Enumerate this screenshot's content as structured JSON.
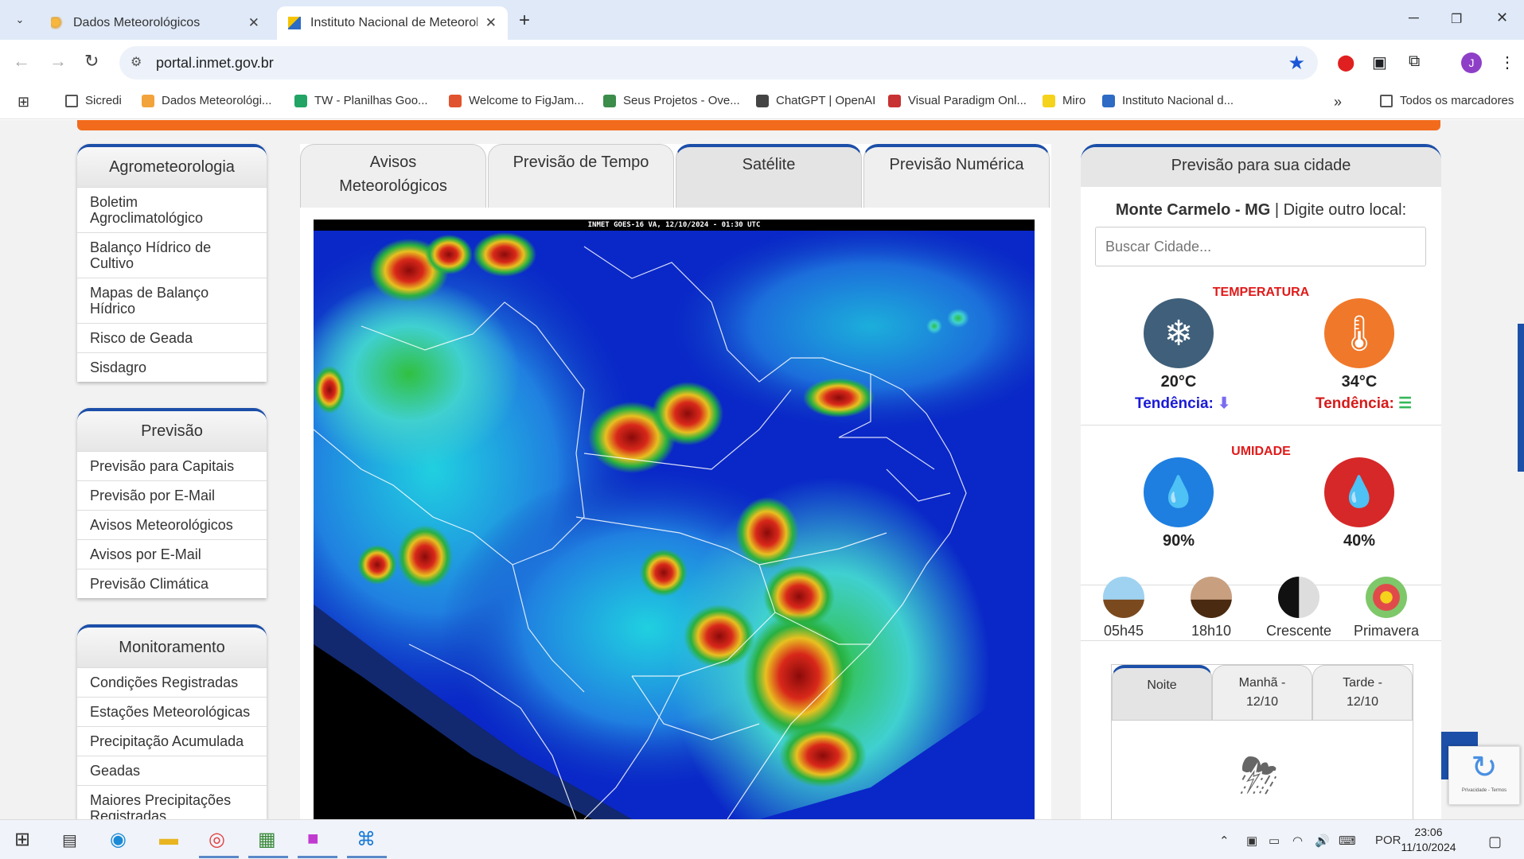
{
  "browser": {
    "tabs": [
      {
        "title": "Dados Meteorológicos"
      },
      {
        "title": "Instituto Nacional de Meteorolo"
      }
    ],
    "url": "portal.inmet.gov.br",
    "avatar_letter": "J",
    "bookmarks": [
      {
        "label": "Sicredi",
        "color": "#666"
      },
      {
        "label": "Dados Meteorológi...",
        "color": "#f2a33c"
      },
      {
        "label": "TW - Planilhas Goo...",
        "color": "#21a464"
      },
      {
        "label": "Welcome to FigJam...",
        "color": "#e0532e"
      },
      {
        "label": "Seus Projetos - Ove...",
        "color": "#3c8c4a"
      },
      {
        "label": "ChatGPT | OpenAI",
        "color": "#444"
      },
      {
        "label": "Visual Paradigm Onl...",
        "color": "#c83232"
      },
      {
        "label": "Miro",
        "color": "#f5d21b"
      },
      {
        "label": "Instituto Nacional d...",
        "color": "#2d6bc4"
      }
    ],
    "all_bookmarks": "Todos os marcadores"
  },
  "sidebar": [
    {
      "title": "Agrometeorologia",
      "items": [
        "Boletim Agroclimatológico",
        "Balanço Hídrico de Cultivo",
        "Mapas de Balanço Hídrico",
        "Risco de Geada",
        "Sisdagro"
      ]
    },
    {
      "title": "Previsão",
      "items": [
        "Previsão para Capitais",
        "Previsão por E-Mail",
        "Avisos Meteorológicos",
        "Avisos por E-Mail",
        "Previsão Climática"
      ]
    },
    {
      "title": "Monitoramento",
      "items": [
        "Condições Registradas",
        "Estações Meteorológicas",
        "Precipitação Acumulada",
        "Geadas",
        "Maiores Precipitações Registradas"
      ]
    }
  ],
  "center": {
    "tabs": [
      "Avisos Meteorológicos",
      "Previsão de Tempo",
      "Satélite",
      "Previsão Numérica"
    ],
    "image_caption": "INMET GOES-16 VA, 12/10/2024 - 01:30 UTC"
  },
  "forecast": {
    "title": "Previsão para sua cidade",
    "city": "Monte Carmelo - MG",
    "city_suffix": " | Digite outro local:",
    "search_placeholder": "Buscar Cidade...",
    "temp_label": "TEMPERATURA",
    "temp_min": "20°C",
    "temp_max": "34°C",
    "trend_label": "Tendência:",
    "humidity_label": "UMIDADE",
    "hum_max": "90%",
    "hum_min": "40%",
    "sunrise": "05h45",
    "sunset": "18h10",
    "moon": "Crescente",
    "season": "Primavera",
    "period_tabs": [
      "Noite",
      "Manhã - 12/10",
      "Tarde - 12/10"
    ],
    "recaptcha": "Privacidade - Termos"
  },
  "taskbar": {
    "lang": "POR",
    "time": "23:06",
    "date": "11/10/2024"
  },
  "colors": {
    "accent": "#1c4fa8",
    "orange": "#f26b1d",
    "red_label": "#e01a1a",
    "trend_down": "#1a1ad6"
  }
}
